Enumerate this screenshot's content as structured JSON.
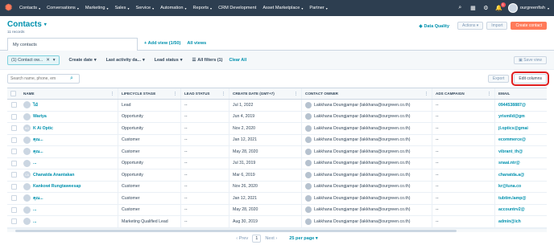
{
  "nav": {
    "items": [
      "Contacts",
      "Conversations",
      "Marketing",
      "Sales",
      "Service",
      "Automation",
      "Reports",
      "CRM Development",
      "Asset Marketplace",
      "Partner"
    ],
    "account": "ourgreenfish",
    "notifications": "1"
  },
  "header": {
    "title": "Contacts",
    "record_count": "11 records",
    "data_quality": "Data Quality",
    "actions": "Actions",
    "import": "Import",
    "create": "Create contact"
  },
  "view": {
    "tab": "My contacts",
    "add_view": "+ Add view (1/50)",
    "all_views": "All views"
  },
  "filters": {
    "chip": "(1) Contact ow...",
    "create_date": "Create date",
    "last_activity": "Last activity da...",
    "lead_status": "Lead status",
    "all_filters": "All filters (1)",
    "clear_all": "Clear All",
    "save_view": "Save view"
  },
  "search": {
    "placeholder": "Search name, phone, em"
  },
  "toolbar": {
    "export": "Export",
    "edit_columns": "Edit columns"
  },
  "columns": [
    "NAME",
    "LIFECYCLE STAGE",
    "LEAD STATUS",
    "CREATE DATE (GMT+7)",
    "CONTACT OWNER",
    "ADS CAMPAIGN",
    "EMAIL"
  ],
  "rows": [
    {
      "name": "ไม้",
      "initials": "",
      "stage": "Lead",
      "status": "--",
      "date": "Jul 1, 2022",
      "owner": "Lakkhana Doungjampar (lakkhana@ourgreen.co.th)",
      "ads": "--",
      "email": "0944538887@"
    },
    {
      "name": "Wariya",
      "initials": "",
      "stage": "Opportunity",
      "status": "--",
      "date": "Jun 4, 2019",
      "owner": "Lakkhana Doungjampar (lakkhana@ourgreen.co.th)",
      "ads": "--",
      "email": "yrismild@gm"
    },
    {
      "name": "K Ai Optic",
      "initials": "KO",
      "stage": "Opportunity",
      "status": "--",
      "date": "Nov 2, 2020",
      "owner": "Lakkhana Doungjampar (lakkhana@ourgreen.co.th)",
      "ads": "--",
      "email": "jl.optics@gmai"
    },
    {
      "name": "คุณ...",
      "initials": "",
      "stage": "Customer",
      "status": "--",
      "date": "Jan 12, 2021",
      "owner": "Lakkhana Doungjampar (lakkhana@ourgreen.co.th)",
      "ads": "--",
      "email": "ecommerce@"
    },
    {
      "name": "คุณ...",
      "initials": "",
      "stage": "Customer",
      "status": "--",
      "date": "May 28, 2020",
      "owner": "Lakkhana Doungjampar (lakkhana@ourgreen.co.th)",
      "ads": "--",
      "email": "vibrant_th@"
    },
    {
      "name": "...",
      "initials": "",
      "stage": "Opportunity",
      "status": "--",
      "date": "Jul 31, 2019",
      "owner": "Lakkhana Doungjampar (lakkhana@ourgreen.co.th)",
      "ads": "--",
      "email": "snaai.ntr@"
    },
    {
      "name": "Chanatda Anantakan",
      "initials": "CA",
      "stage": "Opportunity",
      "status": "--",
      "date": "Mar 6, 2019",
      "owner": "Lakkhana Doungjampar (lakkhana@ourgreen.co.th)",
      "ads": "--",
      "email": "chanatda.a@"
    },
    {
      "name": "Kankowi Rungtaweesap",
      "initials": "",
      "stage": "Customer",
      "status": "--",
      "date": "Nov 26, 2020",
      "owner": "Lakkhana Doungjampar (lakkhana@ourgreen.co.th)",
      "ads": "--",
      "email": "kr@luna.co"
    },
    {
      "name": "คุณ...",
      "initials": "",
      "stage": "Customer",
      "status": "--",
      "date": "Jan 12, 2021",
      "owner": "Lakkhana Doungjampar (lakkhana@ourgreen.co.th)",
      "ads": "--",
      "email": "tubtim.lamp@"
    },
    {
      "name": "...",
      "initials": "",
      "stage": "Customer",
      "status": "--",
      "date": "May 28, 2020",
      "owner": "Lakkhana Doungjampar (lakkhana@ourgreen.co.th)",
      "ads": "--",
      "email": "accountrv2@"
    },
    {
      "name": "...",
      "initials": "",
      "stage": "Marketing Qualified Lead",
      "status": "--",
      "date": "Aug 30, 2019",
      "owner": "Lakkhana Doungjampar (lakkhana@ourgreen.co.th)",
      "ads": "--",
      "email": "admin@ich"
    }
  ],
  "pager": {
    "prev": "Prev",
    "page": "1",
    "next": "Next",
    "per_page": "25 per page"
  }
}
